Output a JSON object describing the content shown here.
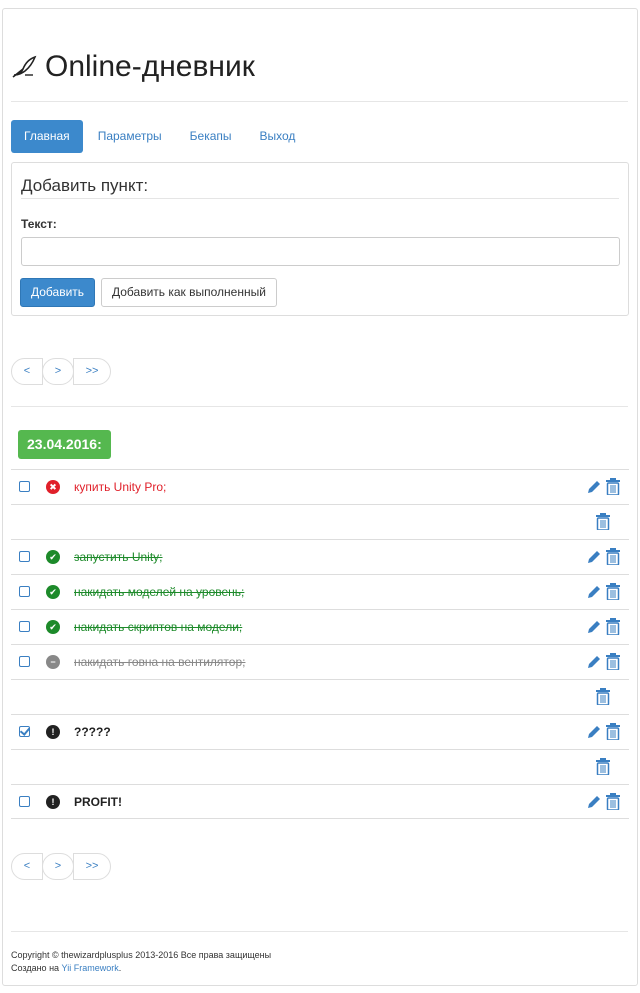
{
  "header": {
    "title": "Online-дневник"
  },
  "nav": [
    {
      "label": "Главная",
      "active": true
    },
    {
      "label": "Параметры",
      "active": false
    },
    {
      "label": "Бекапы",
      "active": false
    },
    {
      "label": "Выход",
      "active": false
    }
  ],
  "form": {
    "title": "Добавить пункт:",
    "text_label": "Текст:",
    "text_value": "",
    "add_label": "Добавить",
    "add_done_label": "Добавить как выполненный"
  },
  "pager": {
    "prev": "<",
    "next": ">",
    "last": ">>"
  },
  "date": "23.04.2016:",
  "items": [
    {
      "text": "купить Unity Pro;",
      "state": "red",
      "checked": false
    },
    {
      "text": "запустить Unity;",
      "state": "green",
      "checked": false
    },
    {
      "text": "накидать моделей на уровень;",
      "state": "green",
      "checked": false
    },
    {
      "text": "накидать скриптов на модели;",
      "state": "green",
      "checked": false
    },
    {
      "text": "накидать говна на вентилятор;",
      "state": "gray",
      "checked": false
    },
    {
      "text": "?????",
      "state": "black",
      "checked": true
    },
    {
      "text": "PROFIT!",
      "state": "black",
      "checked": false
    }
  ],
  "footer": {
    "line1": "Copyright © thewizardplusplus 2013-2016 Все права защищены",
    "line2_prefix": "Создано на ",
    "line2_link": "Yii Framework",
    "line2_suffix": "."
  },
  "colors": {
    "accent": "#3c89cc",
    "success": "#55b84f",
    "danger": "#e0202a",
    "done": "#1d8a2a"
  }
}
